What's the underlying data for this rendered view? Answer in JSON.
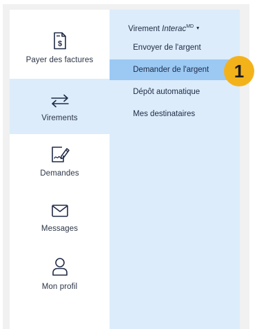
{
  "nav": {
    "items": [
      {
        "label": "Payer des factures",
        "icon": "invoice-dollar-icon"
      },
      {
        "label": "Virements",
        "icon": "transfer-arrows-icon",
        "active": true
      },
      {
        "label": "Demandes",
        "icon": "request-document-pen-icon"
      },
      {
        "label": "Messages",
        "icon": "envelope-icon"
      },
      {
        "label": "Mon profil",
        "icon": "user-profile-icon"
      }
    ]
  },
  "submenu": {
    "header": {
      "prefix": "Virement ",
      "brand": "Interac",
      "superscript": "MD",
      "caret": "▾"
    },
    "items": [
      {
        "label": "Envoyer de l'argent"
      },
      {
        "label": "Demander de l'argent",
        "selected": true
      },
      {
        "label": "Dépôt automatique"
      },
      {
        "label": "Mes destinataires"
      }
    ]
  },
  "callout": {
    "number": "1"
  },
  "colors": {
    "submenu_bg": "#dcecfb",
    "selected_bg": "#9bc9f4",
    "badge": "#f4b21a",
    "frame": "#f1f1f1"
  }
}
